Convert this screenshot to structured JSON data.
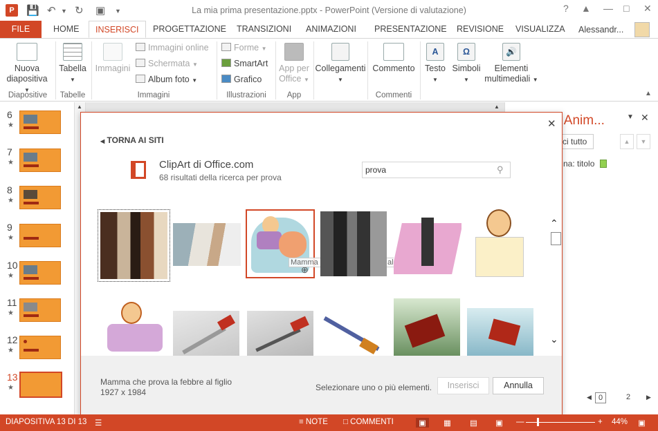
{
  "window": {
    "title": "La mia prima presentazione.pptx - PowerPoint (Versione di valutazione)",
    "help": "?",
    "user": "Alessandr..."
  },
  "tabs": [
    "FILE",
    "HOME",
    "INSERISCI",
    "PROGETTAZIONE",
    "TRANSIZIONI",
    "ANIMAZIONI",
    "PRESENTAZIONE",
    "REVISIONE",
    "VISUALIZZA"
  ],
  "ribbon": {
    "nuova_diapositiva": [
      "Nuova",
      "diapositiva"
    ],
    "tabella": "Tabella",
    "immagini": "Immagini",
    "immagini_online": "Immagini online",
    "schermata": "Schermata",
    "album_foto": "Album foto",
    "forme": "Forme",
    "smartart": "SmartArt",
    "grafico": "Grafico",
    "app_per_office": [
      "App per",
      "Office"
    ],
    "collegamenti": "Collegamenti",
    "commento": "Commento",
    "testo": "Testo",
    "simboli": "Simboli",
    "elementi_multimediali": [
      "Elementi",
      "multimediali"
    ],
    "groups": {
      "diapositive": "Diapositive",
      "tabelle": "Tabelle",
      "immagini": "Immagini",
      "illustrazioni": "Illustrazioni",
      "app": "App",
      "commenti": "Commenti"
    }
  },
  "slides": [
    {
      "num": "6",
      "star": "★"
    },
    {
      "num": "7",
      "star": "★"
    },
    {
      "num": "8",
      "star": "★"
    },
    {
      "num": "9",
      "star": "★"
    },
    {
      "num": "10",
      "star": "★"
    },
    {
      "num": "11",
      "star": "★"
    },
    {
      "num": "12",
      "star": "★"
    },
    {
      "num": "13",
      "star": "★"
    }
  ],
  "right_pane": {
    "title": "o Anim...",
    "play_all": "ci tutto",
    "item": "na: titolo",
    "page_current": "0",
    "page_next": "2"
  },
  "dialog": {
    "back": "TORNA AI SITI",
    "source_title": "ClipArt di Office.com",
    "results": "68 risultati della ricerca per prova",
    "search_value": "prova",
    "hover_tooltip": "Mamma che prova la febbre al figlio",
    "selected_caption": "Mamma che prova la febbre al figlio",
    "selected_size": "1927 x 1984",
    "hint": "Selezionare uno o più elementi.",
    "insert": "Inserisci",
    "cancel": "Annulla",
    "colors": {
      "accent": "#d24726"
    }
  },
  "status": {
    "slide_info": "DIAPOSITIVA 13 DI 13",
    "note": "NOTE",
    "comments": "COMMENTI",
    "zoom": "44%"
  }
}
